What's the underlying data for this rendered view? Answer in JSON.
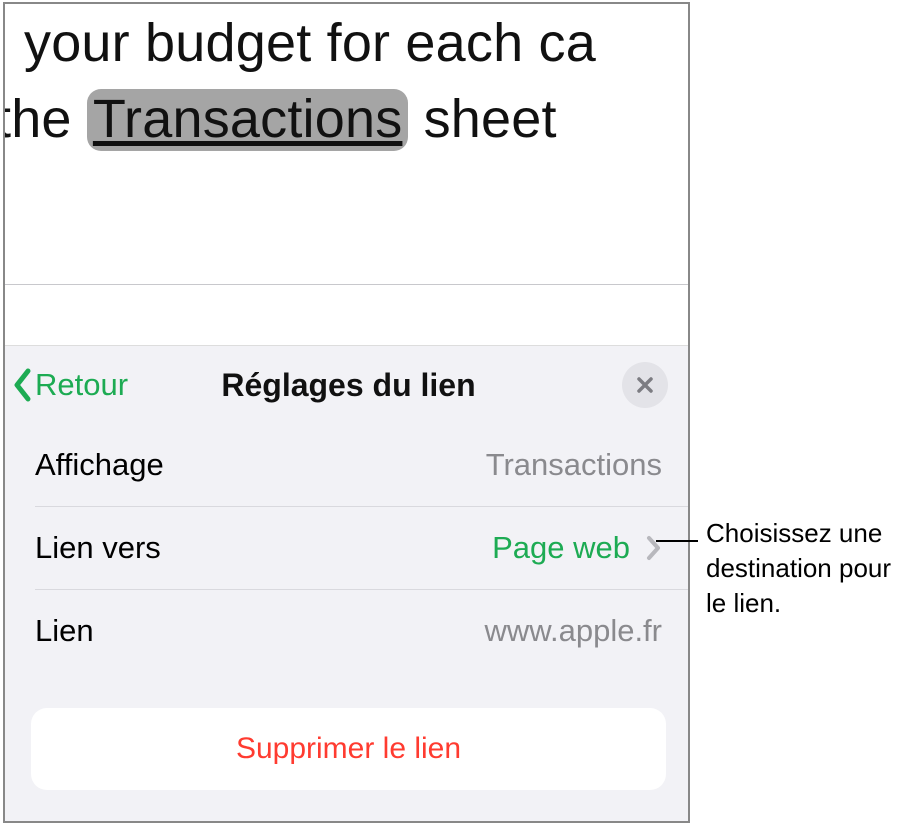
{
  "document": {
    "line1_text": "your budget for each ca",
    "line2_prefix": " the ",
    "line2_highlighted": "Transactions",
    "line2_suffix": " sheet"
  },
  "panel": {
    "back_label": "Retour",
    "title": "Réglages du lien",
    "close_name": "close-icon",
    "rows": {
      "display": {
        "label": "Affichage",
        "value": "Transactions"
      },
      "linkto": {
        "label": "Lien vers",
        "value": "Page web"
      },
      "link": {
        "label": "Lien",
        "value": "www.apple.fr"
      }
    },
    "delete_label": "Supprimer le lien"
  },
  "callout": {
    "text": "Choisissez une destination pour le lien."
  },
  "colors": {
    "accent_green": "#1dab53",
    "destructive_red": "#ff3b30",
    "secondary_text": "#8a8a8e",
    "panel_bg": "#f2f2f6"
  }
}
